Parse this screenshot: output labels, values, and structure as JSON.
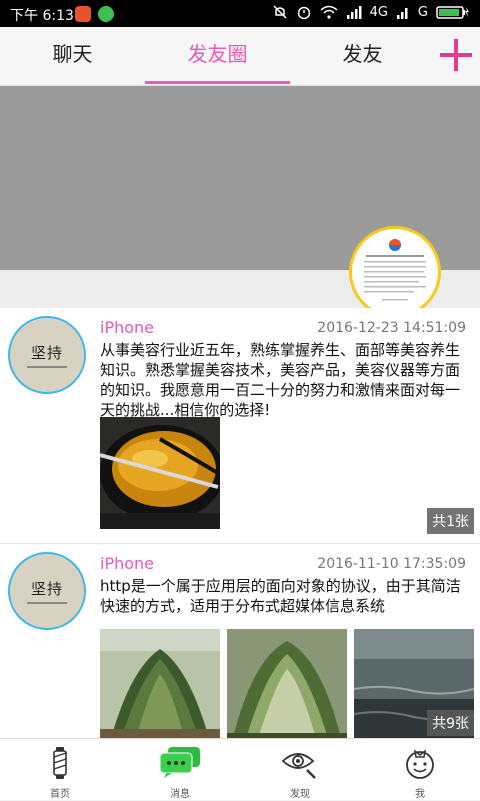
{
  "status_bar": {
    "time": "下午 6:13",
    "network": "4G",
    "network2": "G"
  },
  "tabs": {
    "chat": "聊天",
    "moments": "发友圈",
    "friends": "发友"
  },
  "posts": [
    {
      "author": "iPhone",
      "time": "2016-12-23 14:51:09",
      "text": "从事美容行业近五年，熟练掌握养生、面部等美容养生知识。熟悉掌握美容技术，美容产品，美容仪器等方面的知识。我愿意用一百二十分的努力和激情来面对每一天的挑战...相信你的选择!",
      "avatar_text": "坚持",
      "photo_count": "共1张"
    },
    {
      "author": "iPhone",
      "time": "2016-11-10 17:35:09",
      "text": "http是一个属于应用层的面向对象的协议，由于其简洁快速的方式，适用于分布式超媒体信息系统",
      "avatar_text": "坚持",
      "photo_count": "共9张"
    }
  ],
  "bottom_nav": {
    "home": "首页",
    "messages": "消息",
    "discover": "发现",
    "me": "我"
  },
  "colors": {
    "accent": "#ea59b8",
    "avatar_ring": "#3fb7e8",
    "badge_ring": "#f7c91a",
    "msg_green": "#2dbb3f"
  }
}
